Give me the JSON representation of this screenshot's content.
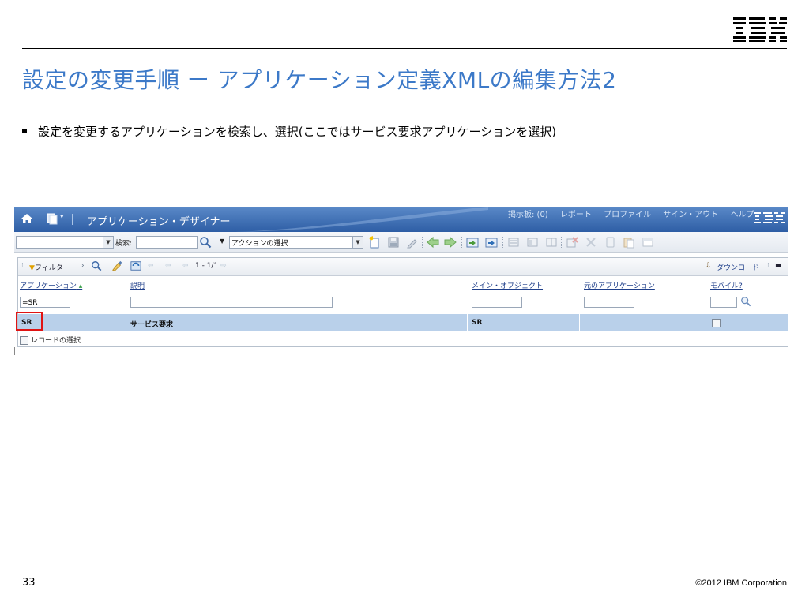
{
  "slide": {
    "title": "設定の変更手順 ー アプリケーション定義XMLの編集方法2",
    "bullet": "設定を変更するアプリケーションを検索し、選択(ここではサービス要求アプリケーションを選択)",
    "page_number": "33",
    "copyright": "©2012 IBM Corporation"
  },
  "app": {
    "title": "アプリケーション・デザイナー",
    "nav": [
      "掲示板: (0)",
      "レポート",
      "プロファイル",
      "サイン・アウト",
      "ヘルプ"
    ],
    "toolbar": {
      "search_label": "検索:",
      "action_select": "アクションの選択"
    },
    "list": {
      "filter_label": "フィルター",
      "pagination": "1 - 1/1",
      "download_label": "ダウンロード",
      "columns": [
        "アプリケーション",
        "説明",
        "メイン・オブジェクト",
        "元のアプリケーション",
        "モバイル?"
      ],
      "filters": {
        "application": "=SR",
        "description": "",
        "main_object": "",
        "original_app": "",
        "mobile": ""
      },
      "rows": [
        {
          "application": "SR",
          "description": "サービス要求",
          "main_object": "SR",
          "original_app": "",
          "mobile": false
        }
      ],
      "select_records": "レコードの選択"
    }
  },
  "colors": {
    "title_blue": "#3c79c8",
    "highlight_row": "#b9d0ea",
    "selection_box": "#e01313"
  }
}
